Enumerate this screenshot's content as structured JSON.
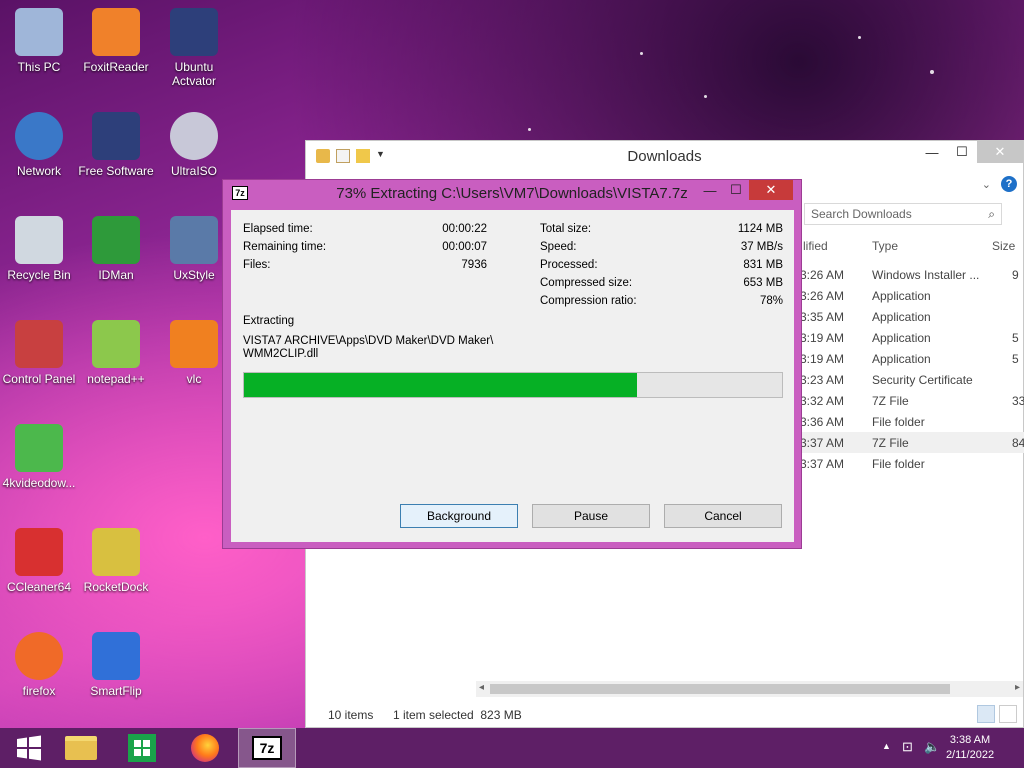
{
  "desktop_icons": [
    {
      "label": "This PC",
      "icon": "computer-icon",
      "color": "#9fb6d9"
    },
    {
      "label": "FoxitReader",
      "icon": "foxit-pdf-icon",
      "color": "#f0812a"
    },
    {
      "label": "Ubuntu\nActvator",
      "icon": "firefox-file-icon",
      "color": "#2d3f7a"
    },
    {
      "label": "Network",
      "icon": "globe-icon",
      "color": "#3a78c8"
    },
    {
      "label": "Free Software",
      "icon": "firefox-file-icon",
      "color": "#2d3f7a"
    },
    {
      "label": "UltraISO",
      "icon": "disc-icon",
      "color": "#c8c8d8"
    },
    {
      "label": "Recycle Bin",
      "icon": "recycle-bin-icon",
      "color": "#d0d8e0"
    },
    {
      "label": "IDMan",
      "icon": "download-manager-icon",
      "color": "#2e9a3a"
    },
    {
      "label": "UxStyle",
      "icon": "installer-icon",
      "color": "#5a7aa8"
    },
    {
      "label": "Control Panel",
      "icon": "control-panel-icon",
      "color": "#c84040"
    },
    {
      "label": "notepad++",
      "icon": "notepad-icon",
      "color": "#8cc84c"
    },
    {
      "label": "vlc",
      "icon": "vlc-cone-icon",
      "color": "#f08020"
    },
    {
      "label": "4kvideodow...",
      "icon": "cloud-download-icon",
      "color": "#4cb84c"
    },
    {
      "label": "CCleaner64",
      "icon": "ccleaner-icon",
      "color": "#d83030"
    },
    {
      "label": "RocketDock",
      "icon": "rocketdock-icon",
      "color": "#d8c040"
    },
    {
      "label": "firefox",
      "icon": "firefox-icon",
      "color": "#f06a28"
    },
    {
      "label": "SmartFlip",
      "icon": "color-fan-icon",
      "color": "#3070d8"
    }
  ],
  "explorer": {
    "title": "Downloads",
    "search_placeholder": "Search Downloads",
    "columns": {
      "modified": "lified",
      "type": "Type",
      "size": "Size"
    },
    "rows": [
      {
        "time": "3:26 AM",
        "type": "Windows Installer ...",
        "size": "9"
      },
      {
        "time": "3:26 AM",
        "type": "Application",
        "size": ""
      },
      {
        "time": "3:35 AM",
        "type": "Application",
        "size": ""
      },
      {
        "time": "3:19 AM",
        "type": "Application",
        "size": "5"
      },
      {
        "time": "3:19 AM",
        "type": "Application",
        "size": "5"
      },
      {
        "time": "3:23 AM",
        "type": "Security Certificate",
        "size": ""
      },
      {
        "time": "3:32 AM",
        "type": "7Z File",
        "size": "33"
      },
      {
        "time": "3:36 AM",
        "type": "File folder",
        "size": ""
      },
      {
        "time": "3:37 AM",
        "type": "7Z File",
        "size": "84"
      },
      {
        "time": "3:37 AM",
        "type": "File folder",
        "size": ""
      }
    ],
    "status_items": "10 items",
    "status_selected": "1 item selected  823 MB"
  },
  "dialog": {
    "title": "73% Extracting C:\\Users\\VM7\\Downloads\\VISTA7.7z",
    "app_icon_text": "7z",
    "left_stats": [
      {
        "label": "Elapsed time:",
        "value": "00:00:22"
      },
      {
        "label": "Remaining time:",
        "value": "00:00:07"
      },
      {
        "label": "Files:",
        "value": "7936"
      }
    ],
    "right_stats": [
      {
        "label": "Total size:",
        "value": "1124 MB"
      },
      {
        "label": "Speed:",
        "value": "37 MB/s"
      },
      {
        "label": "Processed:",
        "value": "831 MB"
      },
      {
        "label": "Compressed size:",
        "value": "653 MB"
      },
      {
        "label": "Compression ratio:",
        "value": "78%"
      }
    ],
    "operation": "Extracting",
    "current_file_line1": "VISTA7 ARCHIVE\\Apps\\DVD Maker\\DVD Maker\\",
    "current_file_line2": "WMM2CLIP.dll",
    "progress_percent": 73,
    "progress_color": "#06b025",
    "buttons": {
      "background": "Background",
      "pause": "Pause",
      "cancel": "Cancel"
    }
  },
  "taskbar": {
    "clock_time": "3:38 AM",
    "clock_date": "2/11/2022",
    "active_app_label": "7z"
  }
}
